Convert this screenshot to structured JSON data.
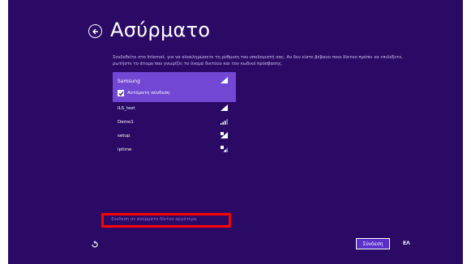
{
  "page": {
    "title": "Ασύρματο",
    "description": "Συνδεθείτε στο Internet, για να ολοκληρώσετε τη ρύθμιση του υπολογιστή σας. Αν δεν είστε βέβαιοι ποιο δίκτυο πρέπει να επιλέξετε, ρωτήστε το άτομο που γνωρίζει το όνομα δικτύου και τον κωδικό πρόσβασης."
  },
  "networks": {
    "selected": {
      "name": "Samsung",
      "auto_connect_label": "Αυτόματη σύνδεση",
      "auto_connect_checked": true
    },
    "others": [
      {
        "name": "ILS_test",
        "signal_icon": "wifi-signal-strong-icon"
      },
      {
        "name": "Demo1",
        "signal_icon": "wifi-signal-medium-icon"
      },
      {
        "name": "setup",
        "signal_icon": "wifi-signal-secured-icon"
      },
      {
        "name": "iptime",
        "signal_icon": "wifi-signal-secured-icon"
      }
    ]
  },
  "footer": {
    "advanced_link": "Σύνδεση σε ασύρματο δίκτυο αργότερα",
    "connect_label": "Σύνδεση",
    "language": "ΕΛ"
  },
  "colors": {
    "background": "#2b0a66",
    "selected_item": "#7247d4",
    "highlight": "#ff0000",
    "link": "#8f78d8"
  }
}
